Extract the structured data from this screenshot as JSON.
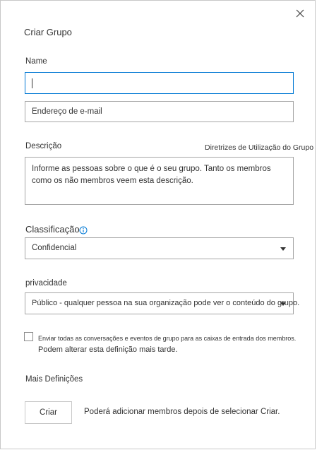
{
  "dialog": {
    "title": "Criar Grupo",
    "close_icon": "close-icon"
  },
  "name": {
    "label": "Name",
    "value": ""
  },
  "email": {
    "value": "Endereço de e-mail"
  },
  "description": {
    "label": "Descrição",
    "guidelines_link": "Diretrizes de Utilização do Grupo",
    "placeholder": "Informe as pessoas sobre o que é o seu grupo. Tanto os membros como os não membros veem esta descrição."
  },
  "classification": {
    "label": "Classificação",
    "info_icon": "info-icon",
    "selected": "Confidencial"
  },
  "privacy": {
    "label": "privacidade",
    "selected": "Público - qualquer pessoa na sua organização pode ver o conteúdo do grupo."
  },
  "subscribe": {
    "checked": false,
    "label": "Enviar todas as conversações e eventos de grupo para as caixas de entrada dos membros.",
    "note": "Podem alterar esta definição mais tarde."
  },
  "more_settings": {
    "label": "Mais Definições"
  },
  "footer": {
    "create_label": "Criar",
    "hint": "Poderá adicionar membros depois de selecionar Criar."
  },
  "colors": {
    "accent": "#0078d4",
    "border": "#a6a6a6",
    "text": "#333333"
  }
}
